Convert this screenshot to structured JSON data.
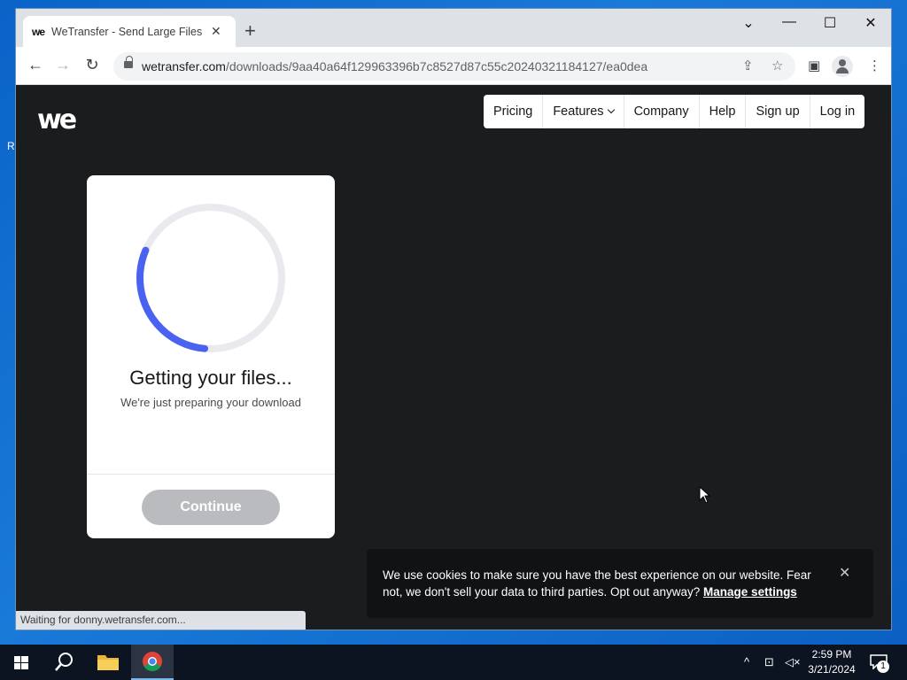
{
  "desktop": {
    "edge_label": "R"
  },
  "browser": {
    "tab_title": "WeTransfer - Send Large Files &",
    "tab_favicon": "we",
    "url_domain": "wetransfer.com",
    "url_path": "/downloads/9aa40a64f129963396b7c8527d87c55c20240321184127/ea0dea",
    "status_text": "Waiting for donny.wetransfer.com..."
  },
  "site": {
    "logo": "we",
    "nav": {
      "pricing": "Pricing",
      "features": "Features",
      "company": "Company",
      "help": "Help",
      "signup": "Sign up",
      "login": "Log in"
    },
    "download_card": {
      "title": "Getting your files...",
      "subtitle": "We're just preparing your download",
      "continue_label": "Continue",
      "progress_fraction": 0.3
    },
    "cookie_banner": {
      "text": "We use cookies to make sure you have the best experience on our website. Fear not, we don't sell your data to third parties. Opt out anyway?",
      "link": "Manage settings"
    }
  },
  "taskbar": {
    "time": "2:59 PM",
    "date": "3/21/2024",
    "notification_count": "1"
  },
  "colors": {
    "accent_blue": "#4a62f0",
    "page_background": "#1b1c1e",
    "desktop_blue": "#0a63c8"
  }
}
